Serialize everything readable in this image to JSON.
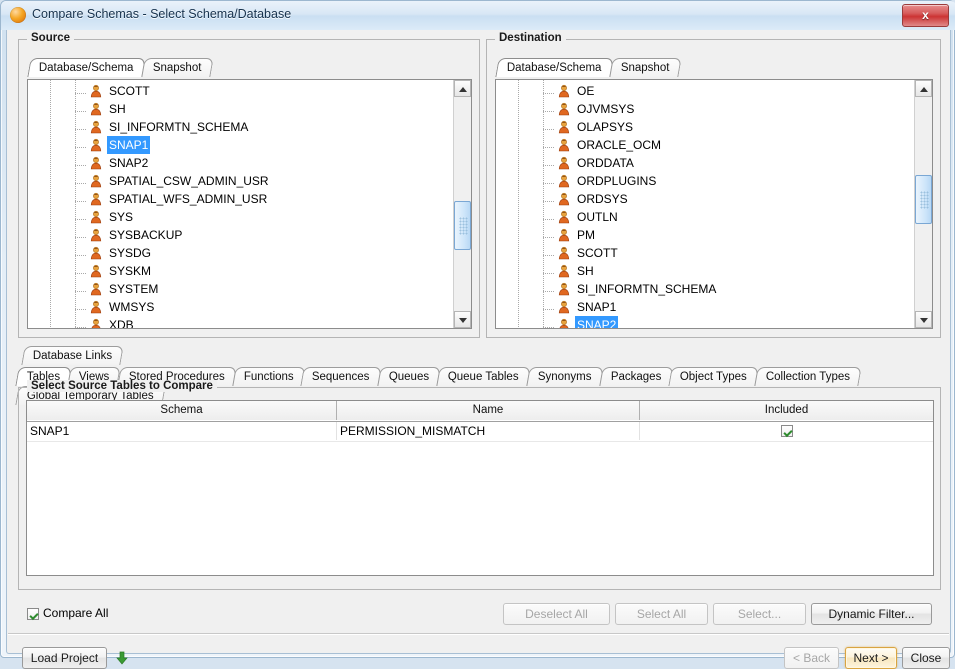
{
  "window": {
    "title": "Compare Schemas - Select Schema/Database",
    "app_icon": "oracle-sphere-icon",
    "close_label": "x"
  },
  "source": {
    "legend": "Source",
    "tabs": [
      {
        "label": "Database/Schema",
        "selected": true
      },
      {
        "label": "Snapshot",
        "selected": false
      }
    ],
    "items": [
      {
        "label": "SCOTT",
        "selected": false
      },
      {
        "label": "SH",
        "selected": false
      },
      {
        "label": "SI_INFORMTN_SCHEMA",
        "selected": false
      },
      {
        "label": "SNAP1",
        "selected": true
      },
      {
        "label": "SNAP2",
        "selected": false
      },
      {
        "label": "SPATIAL_CSW_ADMIN_USR",
        "selected": false
      },
      {
        "label": "SPATIAL_WFS_ADMIN_USR",
        "selected": false
      },
      {
        "label": "SYS",
        "selected": false
      },
      {
        "label": "SYSBACKUP",
        "selected": false
      },
      {
        "label": "SYSDG",
        "selected": false
      },
      {
        "label": "SYSKM",
        "selected": false
      },
      {
        "label": "SYSTEM",
        "selected": false
      },
      {
        "label": "WMSYS",
        "selected": false
      },
      {
        "label": "XDB",
        "selected": false
      }
    ],
    "item_icon": "user-schema-icon",
    "scrollbar": {
      "up_icon": "scroll-up-arrow-icon",
      "down_icon": "scroll-down-arrow-icon",
      "thumb_top_pct": 63,
      "thumb_height_pct": 23
    }
  },
  "destination": {
    "legend": "Destination",
    "tabs": [
      {
        "label": "Database/Schema",
        "selected": true
      },
      {
        "label": "Snapshot",
        "selected": false
      }
    ],
    "items": [
      {
        "label": "OE",
        "selected": false
      },
      {
        "label": "OJVMSYS",
        "selected": false
      },
      {
        "label": "OLAPSYS",
        "selected": false
      },
      {
        "label": "ORACLE_OCM",
        "selected": false
      },
      {
        "label": "ORDDATA",
        "selected": false
      },
      {
        "label": "ORDPLUGINS",
        "selected": false
      },
      {
        "label": "ORDSYS",
        "selected": false
      },
      {
        "label": "OUTLN",
        "selected": false
      },
      {
        "label": "PM",
        "selected": false
      },
      {
        "label": "SCOTT",
        "selected": false
      },
      {
        "label": "SH",
        "selected": false
      },
      {
        "label": "SI_INFORMTN_SCHEMA",
        "selected": false
      },
      {
        "label": "SNAP1",
        "selected": false
      },
      {
        "label": "SNAP2",
        "selected": true
      }
    ],
    "item_icon": "user-schema-icon",
    "scrollbar": {
      "up_icon": "scroll-up-arrow-icon",
      "down_icon": "scroll-down-arrow-icon",
      "thumb_top_pct": 47,
      "thumb_height_pct": 23
    }
  },
  "object_tabs": {
    "top_row": [
      {
        "label": "Database Links",
        "selected": false
      }
    ],
    "main_row": [
      {
        "label": "Tables",
        "selected": true
      },
      {
        "label": "Views",
        "selected": false
      },
      {
        "label": "Stored Procedures",
        "selected": false
      },
      {
        "label": "Functions",
        "selected": false
      },
      {
        "label": "Sequences",
        "selected": false
      },
      {
        "label": "Queues",
        "selected": false
      },
      {
        "label": "Queue Tables",
        "selected": false
      },
      {
        "label": "Synonyms",
        "selected": false
      },
      {
        "label": "Packages",
        "selected": false
      },
      {
        "label": "Object Types",
        "selected": false
      },
      {
        "label": "Collection Types",
        "selected": false
      },
      {
        "label": "Global Temporary Tables",
        "selected": false
      }
    ]
  },
  "table_panel": {
    "legend": "Select Source Tables to Compare",
    "columns": [
      "Schema",
      "Name",
      "Included"
    ],
    "rows": [
      {
        "schema": "SNAP1",
        "name": "PERMISSION_MISMATCH",
        "included": true
      }
    ]
  },
  "footer": {
    "compare_all_label": "Compare All",
    "compare_all_checked": true,
    "buttons": [
      {
        "label": "Deselect All",
        "disabled": true
      },
      {
        "label": "Select All",
        "disabled": true
      },
      {
        "label": "Select...",
        "disabled": true
      },
      {
        "label": "Dynamic Filter...",
        "disabled": false
      }
    ]
  },
  "bottom_bar": {
    "load_project_label": "Load Project",
    "download_icon": "green-down-arrow-icon",
    "back_label": "< Back",
    "back_disabled": true,
    "next_label": "Next >",
    "next_focused": true,
    "close_label": "Close"
  },
  "colors": {
    "selection": "#3399ff",
    "title_text": "#17324d",
    "check": "#2e8b2e",
    "focus_ring": "#d9a441"
  }
}
